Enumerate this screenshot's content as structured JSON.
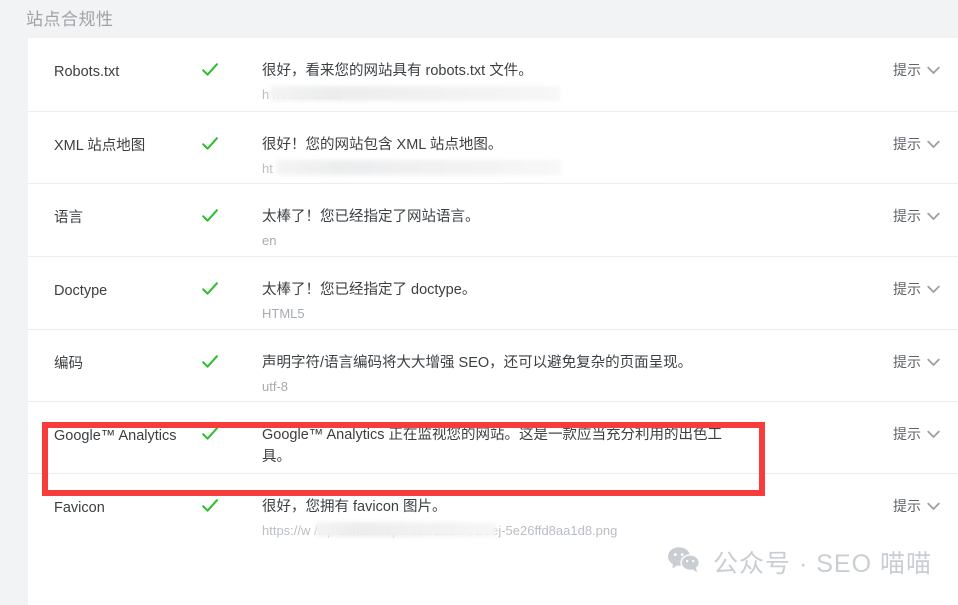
{
  "page": {
    "title": "站点合规性",
    "background_color": "#f2f3f4",
    "card_background": "#ffffff",
    "check_color": "#2fbf2f",
    "highlight_color": "#f83b3b",
    "hint_label": "提示"
  },
  "checks": [
    {
      "name": "Robots.txt",
      "status_icon": "check-icon",
      "description": "很好，看来您的网站具有 robots.txt 文件。",
      "url": "h                                          m/robots.txt",
      "url_redacted": true,
      "action_label": "提示"
    },
    {
      "name": "XML 站点地图",
      "status_icon": "check-icon",
      "description": "很好！您的网站包含 XML 站点地图。",
      "url": "ht                                                  ",
      "url_redacted": true,
      "action_label": "提示"
    },
    {
      "name": "语言",
      "status_icon": "check-icon",
      "description": "太棒了！您已经指定了网站语言。",
      "url": "en",
      "url_redacted": false,
      "action_label": "提示"
    },
    {
      "name": "Doctype",
      "status_icon": "check-icon",
      "description": "太棒了！您已经指定了 doctype。",
      "url": "HTML5",
      "url_redacted": false,
      "action_label": "提示"
    },
    {
      "name": "编码",
      "status_icon": "check-icon",
      "description": "声明字符/语言编码将大大增强 SEO，还可以避免复杂的页面呈现。",
      "url": "utf-8",
      "url_redacted": false,
      "action_label": "提示"
    },
    {
      "name": "Google™ Analytics",
      "status_icon": "check-icon",
      "description": "Google™ Analytics 正在监视您的网站。这是一款应当充分利用的出色工具。",
      "url": "",
      "url_redacted": false,
      "action_label": "提示",
      "highlighted": true
    },
    {
      "name": "Favicon",
      "status_icon": "check-icon",
      "description": "很好，您拥有 favicon 图片。",
      "url": "https://w                                       /wp-content/uploads/2020/01/sej-5e26ffd8aa1d8.png",
      "url_redacted": true,
      "action_label": "提示"
    }
  ],
  "watermark": {
    "icon": "wechat-icon",
    "text": "公众号 · SEO 喵喵"
  }
}
